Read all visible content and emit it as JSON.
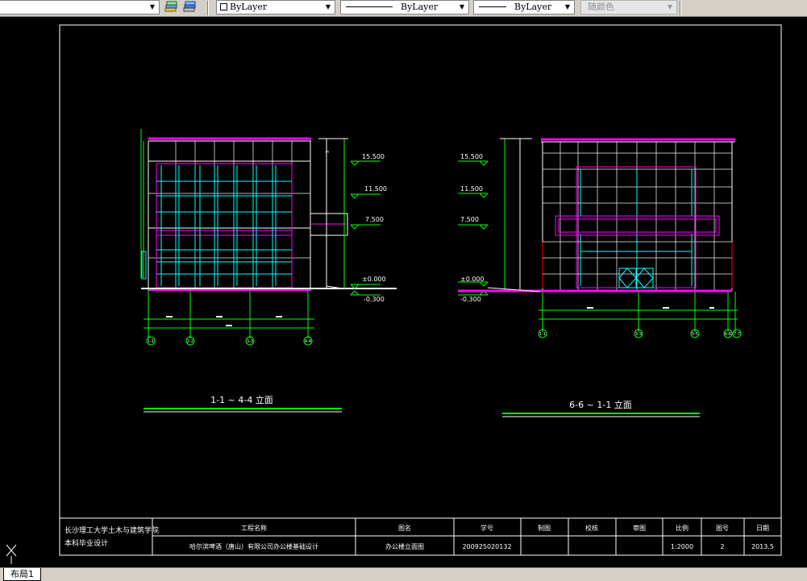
{
  "toolbar": {
    "layer_color_combo": "ByLayer",
    "linetype_combo": "ByLayer",
    "lineweight_combo": "ByLayer",
    "plotstyle_combo": "随颜色"
  },
  "layout_tab": "布局1",
  "elevation_left": {
    "levels": [
      "15.500",
      "11.500",
      "7.500",
      "±0.000",
      "-0.300"
    ],
    "axes": [
      "1-1",
      "2-2",
      "3-3",
      "4-4"
    ],
    "title": "1-1 ~ 4-4 立面"
  },
  "elevation_right": {
    "levels": [
      "15.500",
      "11.500",
      "7.500",
      "±0.000",
      "-0.300"
    ],
    "axes": [
      "1-1",
      "3-3",
      "5-5",
      "6-6",
      "7-7"
    ],
    "title": "6-6 ~ 1-1 立面"
  },
  "title_block": {
    "school_line1": "长沙理工大学土木与建筑学院",
    "school_line2": "本科毕业设计",
    "project_name_label": "工程名称",
    "project_name_value": "哈尔滨啤酒（唐山）有限公司办公楼基础设计",
    "drawing_name_label": "图名",
    "drawing_name_value": "办公楼立面图",
    "student_id_label": "学号",
    "student_id_value": "200925020132",
    "drawn_label": "制图",
    "checked_label": "校核",
    "approved_label": "审图",
    "scale_label": "比例",
    "scale_value": "1:2000",
    "sheet_label": "图号",
    "sheet_value": "2",
    "date_label": "日期",
    "date_value": "2013.5"
  },
  "colors": {
    "frame": "#ffffff",
    "magenta": "#ff00ff",
    "cyan": "#00ffff",
    "green": "#00ff00",
    "red": "#ff0000",
    "background": "#000000"
  }
}
